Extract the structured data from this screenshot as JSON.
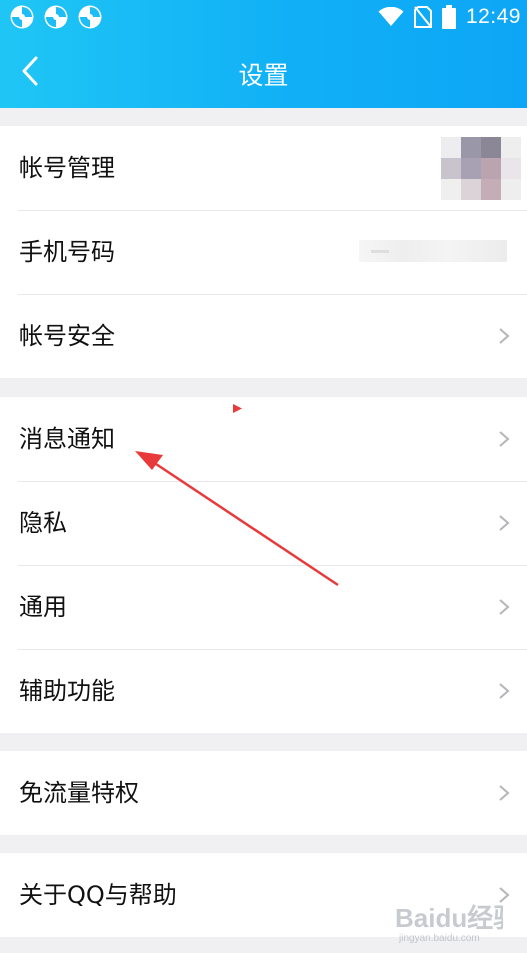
{
  "status_bar": {
    "time": "12:49",
    "left_icons": [
      "app-notification-icon",
      "app-notification-icon",
      "app-notification-icon"
    ],
    "right_icons": [
      "wifi-icon",
      "no-sim-icon",
      "battery-icon"
    ]
  },
  "navbar": {
    "back_icon": "chevron-left-icon",
    "title": "设置"
  },
  "groups": [
    {
      "items": [
        {
          "label": "帐号管理",
          "trailing": "avatar"
        },
        {
          "label": "手机号码",
          "trailing": "masked-phone"
        },
        {
          "label": "帐号安全",
          "trailing": "chevron-right-icon"
        }
      ]
    },
    {
      "items": [
        {
          "label": "消息通知",
          "trailing": "chevron-right-icon"
        },
        {
          "label": "隐私",
          "trailing": "chevron-right-icon"
        },
        {
          "label": "通用",
          "trailing": "chevron-right-icon"
        },
        {
          "label": "辅助功能",
          "trailing": "chevron-right-icon"
        }
      ]
    },
    {
      "items": [
        {
          "label": "免流量特权",
          "trailing": "chevron-right-icon"
        }
      ]
    },
    {
      "items": [
        {
          "label": "关于QQ与帮助",
          "trailing": "chevron-right-icon"
        }
      ]
    }
  ],
  "avatar_mosaic": [
    "#ededef",
    "#9a98a8",
    "#8b8797",
    "#eeeeef",
    "#c8c3cd",
    "#a7a1b3",
    "#b9a4b0",
    "#e9e5e8",
    "#f0eff0",
    "#dcd3d8",
    "#c4adb6",
    "#eeeeee"
  ],
  "colors": {
    "header_start": "#1fc6f5",
    "header_end": "#0da6f6",
    "annotation_arrow": "#e83a3a"
  },
  "watermark": {
    "text": "Baidu经验",
    "sub": "jingyan.baidu.com"
  }
}
